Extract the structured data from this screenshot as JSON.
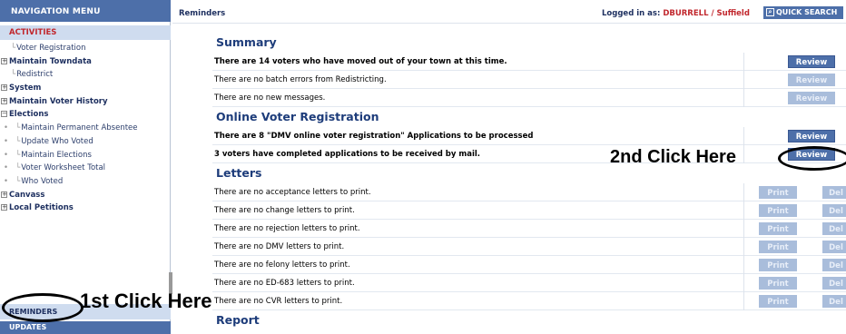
{
  "sidebar": {
    "header": "NAVIGATION MENU",
    "activities": "ACTIVITIES",
    "items": [
      {
        "label": "Voter Registration",
        "bold": false,
        "prefix": "line"
      },
      {
        "label": "Maintain Towndata",
        "bold": true,
        "prefix": "exp"
      },
      {
        "label": "Redistrict",
        "bold": false,
        "prefix": "line"
      },
      {
        "label": "System",
        "bold": true,
        "prefix": "exp"
      },
      {
        "label": "Maintain Voter History",
        "bold": true,
        "prefix": "exp"
      },
      {
        "label": "Elections",
        "bold": true,
        "prefix": "collapse"
      },
      {
        "label": "Maintain Permanent Absentee",
        "bold": false,
        "prefix": "sub"
      },
      {
        "label": "Update Who Voted",
        "bold": false,
        "prefix": "sub"
      },
      {
        "label": "Maintain Elections",
        "bold": false,
        "prefix": "sub"
      },
      {
        "label": "Voter Worksheet Total",
        "bold": false,
        "prefix": "sub"
      },
      {
        "label": "Who Voted",
        "bold": false,
        "prefix": "sub"
      },
      {
        "label": "Canvass",
        "bold": true,
        "prefix": "exp"
      },
      {
        "label": "Local Petitions",
        "bold": true,
        "prefix": "exp"
      }
    ],
    "reminders": "REMINDERS",
    "updates": "UPDATES"
  },
  "annotations": {
    "first_click": "1st Click Here",
    "second_click": "2nd Click Here"
  },
  "topbar": {
    "title": "Reminders",
    "logged_label": "Logged in as:",
    "user": "DBURRELL / Suffield",
    "quick_search": "QUICK SEARCH"
  },
  "sections": {
    "summary": {
      "title": "Summary",
      "rows": [
        {
          "text": "There are 14 voters who have moved out of your town at this time.",
          "bold": true,
          "button": "Review",
          "enabled": true
        },
        {
          "text": "There are no batch errors from Redistricting.",
          "bold": false,
          "button": "Review",
          "enabled": false
        },
        {
          "text": "There are no new messages.",
          "bold": false,
          "button": "Review",
          "enabled": false
        }
      ]
    },
    "ovr": {
      "title": "Online Voter Registration",
      "rows": [
        {
          "text": "There are 8 \"DMV online voter registration\" Applications to be processed",
          "bold": true,
          "button": "Review",
          "enabled": true
        },
        {
          "text": "3 voters have completed applications to be received by mail.",
          "bold": true,
          "button": "Review",
          "enabled": true
        }
      ]
    },
    "letters": {
      "title": "Letters",
      "print_label": "Print",
      "del_label": "Del",
      "rows": [
        "There are no acceptance letters to print.",
        "There are no change letters to print.",
        "There are no rejection letters to print.",
        "There are no DMV letters to print.",
        "There are no felony letters to print.",
        "There are no ED-683 letters to print.",
        "There are no CVR letters to print."
      ]
    },
    "report": {
      "title": "Report"
    }
  }
}
